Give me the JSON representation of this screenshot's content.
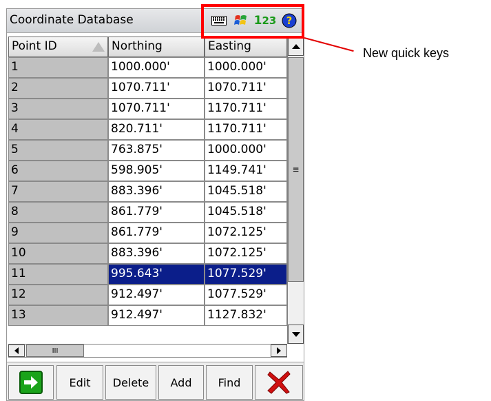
{
  "window": {
    "title": "Coordinate Database"
  },
  "quick_keys": {
    "number_label": "1",
    "number_sub": "23",
    "callout_label": "New quick keys"
  },
  "columns": {
    "id": "Point ID",
    "northing": "Northing",
    "easting": "Easting"
  },
  "rows": [
    {
      "id": "1",
      "northing": "1000.000'",
      "easting": "1000.000'",
      "selected": false
    },
    {
      "id": "2",
      "northing": "1070.711'",
      "easting": "1070.711'",
      "selected": false
    },
    {
      "id": "3",
      "northing": "1070.711'",
      "easting": "1170.711'",
      "selected": false
    },
    {
      "id": "4",
      "northing": "820.711'",
      "easting": "1170.711'",
      "selected": false
    },
    {
      "id": "5",
      "northing": "763.875'",
      "easting": "1000.000'",
      "selected": false
    },
    {
      "id": "6",
      "northing": "598.905'",
      "easting": "1149.741'",
      "selected": false
    },
    {
      "id": "7",
      "northing": "883.396'",
      "easting": "1045.518'",
      "selected": false
    },
    {
      "id": "8",
      "northing": "861.779'",
      "easting": "1045.518'",
      "selected": false
    },
    {
      "id": "9",
      "northing": "861.779'",
      "easting": "1072.125'",
      "selected": false
    },
    {
      "id": "10",
      "northing": "883.396'",
      "easting": "1072.125'",
      "selected": false
    },
    {
      "id": "11",
      "northing": "995.643'",
      "easting": "1077.529'",
      "selected": true
    },
    {
      "id": "12",
      "northing": "912.497'",
      "easting": "1077.529'",
      "selected": false
    },
    {
      "id": "13",
      "northing": "912.497'",
      "easting": "1127.832'",
      "selected": false
    }
  ],
  "toolbar": {
    "edit": "Edit",
    "delete": "Delete",
    "add": "Add",
    "find": "Find"
  },
  "colors": {
    "selection": "#0b1e8a",
    "highlight": "#ff0000",
    "go_green": "#1aa31a",
    "close_red": "#d01010",
    "help_blue": "#1a3fd1",
    "number_green": "#1a9a1a"
  }
}
